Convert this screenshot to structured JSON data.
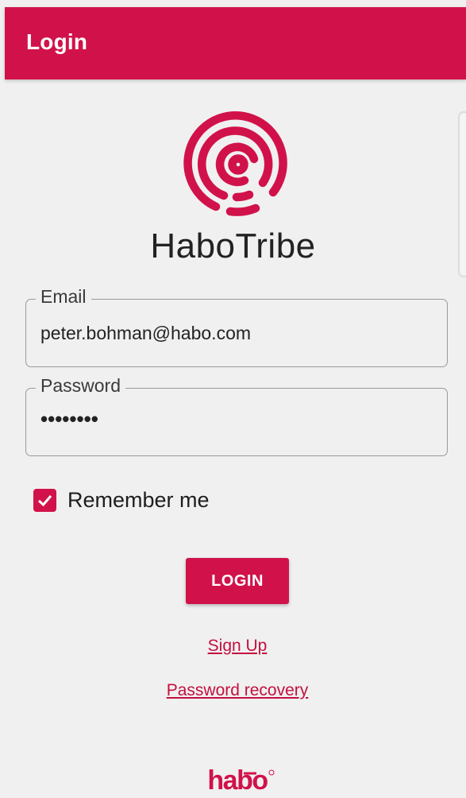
{
  "header": {
    "title": "Login"
  },
  "brand": {
    "name": "HaboTribe",
    "footer_logo_text": "habo"
  },
  "form": {
    "email": {
      "label": "Email",
      "value": "peter.bohman@habo.com"
    },
    "password": {
      "label": "Password",
      "value": "••••••••"
    },
    "remember": {
      "label": "Remember me",
      "checked": true
    },
    "submit_label": "LOGIN"
  },
  "links": {
    "signup": "Sign Up",
    "recovery": "Password recovery"
  },
  "colors": {
    "accent": "#d1124a",
    "background": "#f0f0f0",
    "text": "#222222"
  },
  "icons": {
    "brand_mark": "concentric-spiral-logo",
    "check": "checkmark-icon"
  }
}
